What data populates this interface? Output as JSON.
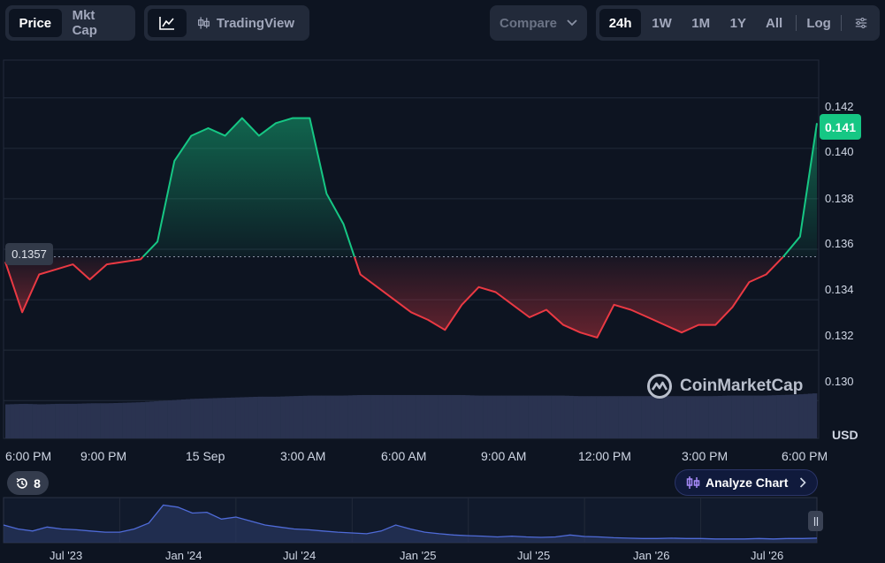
{
  "toolbar": {
    "view_tabs": [
      {
        "label": "Price",
        "active": true
      },
      {
        "label": "Mkt Cap",
        "active": false
      }
    ],
    "chart_type": {
      "icon": "line-chart-icon",
      "tradingview_icon": "candlestick-icon",
      "tradingview_label": "TradingView"
    },
    "compare": {
      "label": "Compare",
      "icon": "chevron-down-icon"
    },
    "ranges": [
      {
        "label": "24h",
        "active": true
      },
      {
        "label": "1W",
        "active": false
      },
      {
        "label": "1M",
        "active": false
      },
      {
        "label": "1Y",
        "active": false
      },
      {
        "label": "All",
        "active": false
      }
    ],
    "log_label": "Log",
    "settings_icon": "sliders-icon"
  },
  "chart": {
    "current_price": "0.141",
    "reference_price": "0.1357",
    "currency": "USD",
    "watermark": "CoinMarketCap",
    "y_ticks": [
      "0.142",
      "0.140",
      "0.138",
      "0.136",
      "0.134",
      "0.132",
      "0.130"
    ],
    "x_ticks": [
      "6:00 PM",
      "9:00 PM",
      "15 Sep",
      "3:00 AM",
      "6:00 AM",
      "9:00 AM",
      "12:00 PM",
      "3:00 PM",
      "6:00 PM"
    ],
    "colors": {
      "up": "#16c784",
      "down": "#ea3943",
      "volume": "#2a3350",
      "background": "#0d1421"
    }
  },
  "events_badge": {
    "icon": "history-icon",
    "count": "8"
  },
  "analyze_button": {
    "icon": "analyze-icon",
    "label": "Analyze Chart",
    "chevron": "chevron-right-icon"
  },
  "navigator": {
    "ticks": [
      "Jul '23",
      "Jan '24",
      "Jul '24",
      "Jan '25",
      "Jul '25",
      "Jan '26",
      "Jul '26"
    ],
    "handle_icon": "drag-handle-icon"
  },
  "chart_data": {
    "type": "line",
    "title": "",
    "xlabel": "",
    "ylabel": "USD",
    "ylim": [
      0.1285,
      0.1435
    ],
    "baseline": 0.1357,
    "x": [
      "6:00 PM",
      "6:30 PM",
      "7:00 PM",
      "7:30 PM",
      "8:00 PM",
      "8:30 PM",
      "9:00 PM",
      "9:30 PM",
      "10:00 PM",
      "10:30 PM",
      "11:00 PM",
      "11:30 PM",
      "15 Sep",
      "12:30 AM",
      "1:00 AM",
      "1:30 AM",
      "2:00 AM",
      "2:30 AM",
      "3:00 AM",
      "3:30 AM",
      "4:00 AM",
      "4:30 AM",
      "5:00 AM",
      "5:30 AM",
      "6:00 AM",
      "6:30 AM",
      "7:00 AM",
      "7:30 AM",
      "8:00 AM",
      "8:30 AM",
      "9:00 AM",
      "9:30 AM",
      "10:00 AM",
      "10:30 AM",
      "11:00 AM",
      "11:30 AM",
      "12:00 PM",
      "12:30 PM",
      "1:00 PM",
      "1:30 PM",
      "2:00 PM",
      "2:30 PM",
      "3:00 PM",
      "3:30 PM",
      "4:00 PM",
      "4:30 PM",
      "5:00 PM",
      "5:30 PM",
      "6:00 PM"
    ],
    "series": [
      {
        "values": [
          0.1355,
          0.1335,
          0.135,
          0.1352,
          0.1354,
          0.1348,
          0.1354,
          0.1355,
          0.1356,
          0.1363,
          0.1395,
          0.1405,
          0.1408,
          0.1405,
          0.1412,
          0.1405,
          0.141,
          0.1412,
          0.1412,
          0.1382,
          0.137,
          0.135,
          0.1345,
          0.134,
          0.1335,
          0.1332,
          0.1328,
          0.1338,
          0.1345,
          0.1343,
          0.1338,
          0.1333,
          0.1336,
          0.133,
          0.1327,
          0.1325,
          0.1338,
          0.1336,
          0.1333,
          0.133,
          0.1327,
          0.133,
          0.133,
          0.1337,
          0.1347,
          0.135,
          0.1357,
          0.1365,
          0.141
        ]
      }
    ],
    "volume": [
      0.62,
      0.63,
      0.62,
      0.63,
      0.63,
      0.64,
      0.64,
      0.65,
      0.66,
      0.68,
      0.7,
      0.72,
      0.73,
      0.74,
      0.75,
      0.76,
      0.76,
      0.77,
      0.78,
      0.78,
      0.78,
      0.79,
      0.79,
      0.79,
      0.79,
      0.79,
      0.79,
      0.79,
      0.78,
      0.78,
      0.78,
      0.78,
      0.78,
      0.78,
      0.77,
      0.77,
      0.77,
      0.77,
      0.77,
      0.77,
      0.77,
      0.77,
      0.77,
      0.78,
      0.78,
      0.78,
      0.79,
      0.8,
      0.82
    ],
    "navigator_series": [
      0.4,
      0.3,
      0.25,
      0.35,
      0.3,
      0.28,
      0.25,
      0.22,
      0.22,
      0.3,
      0.45,
      0.9,
      0.85,
      0.7,
      0.72,
      0.55,
      0.6,
      0.5,
      0.4,
      0.35,
      0.3,
      0.28,
      0.25,
      0.22,
      0.2,
      0.18,
      0.25,
      0.4,
      0.3,
      0.22,
      0.18,
      0.15,
      0.13,
      0.12,
      0.1,
      0.12,
      0.1,
      0.09,
      0.1,
      0.15,
      0.11,
      0.1,
      0.08,
      0.07,
      0.06,
      0.06,
      0.07,
      0.06,
      0.06,
      0.05,
      0.05,
      0.05,
      0.06,
      0.05,
      0.06,
      0.06,
      0.07
    ]
  }
}
